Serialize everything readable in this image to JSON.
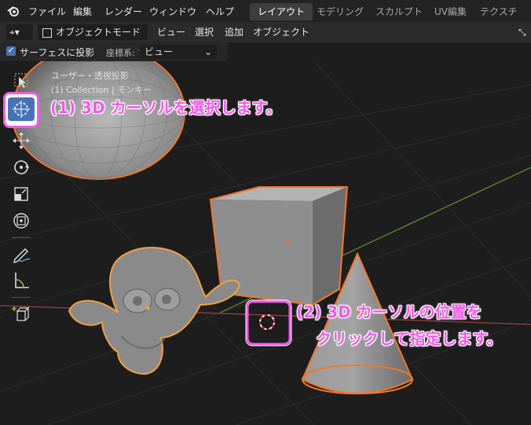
{
  "topbar": {
    "menu": [
      "ファイル",
      "編集",
      "レンダー",
      "ウィンドウ",
      "ヘルプ"
    ],
    "workspaces": [
      "レイアウト",
      "モデリング",
      "スカルプト",
      "UV編集",
      "テクスチャペ"
    ],
    "active_workspace": "レイアウト"
  },
  "header": {
    "mode": "オブジェクトモード",
    "menus": [
      "ビュー",
      "選択",
      "追加",
      "オブジェクト"
    ]
  },
  "tool_settings": {
    "surface_project_label": "サーフェスに投影",
    "surface_project_checked": true,
    "orientation_label": "座標系:",
    "orientation_value": "ビュー"
  },
  "viewport": {
    "view_name": "ユーザー・透視投影",
    "collection_info": "(1) Collection | モンキー"
  },
  "toolbar": {
    "tools": [
      "select-box-tool",
      "cursor-tool",
      "move-tool",
      "rotate-tool",
      "scale-tool",
      "transform-tool",
      "annotate-tool",
      "measure-tool",
      "add-cube-tool"
    ],
    "active_tool": "cursor-tool"
  },
  "annotations": {
    "step1": "(1) 3D カーソルを選択します。",
    "step2_line1": "(2) 3D カーソルの位置を",
    "step2_line2": "クリックして指定します。"
  },
  "colors": {
    "accent": "#4772b3",
    "selection_outline": "#f0782a",
    "annotation": "#f05be8",
    "x_axis": "#8a3a3a",
    "y_axis": "#5b7a2a"
  }
}
